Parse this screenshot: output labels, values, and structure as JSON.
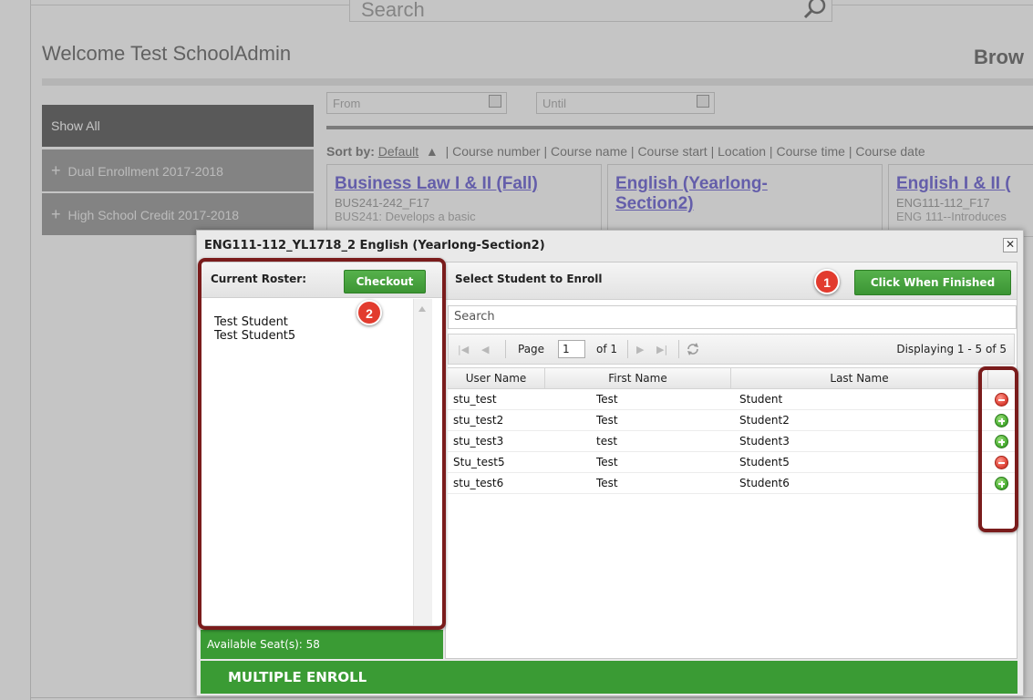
{
  "background": {
    "search_text": "Search",
    "welcome": "Welcome Test SchoolAdmin",
    "browse_fragment": "Brow",
    "sidebar": [
      {
        "label": "Show All",
        "prefix": ""
      },
      {
        "label": "Dual Enrollment 2017-2018",
        "prefix": "+"
      },
      {
        "label": "High School Credit 2017-2018",
        "prefix": "+"
      }
    ],
    "from_placeholder": "From",
    "until_placeholder": "Until",
    "sort_prefix": "Sort by:",
    "sort_default": "Default",
    "sort_rest": " | Course number | Course name | Course start | Location | Course time | Course date",
    "cards": [
      {
        "title": "Business Law I & II (Fall)",
        "code": "BUS241-242_F17",
        "desc": "BUS241: Develops a basic"
      },
      {
        "title": "English (Yearlong-Section2)",
        "code": "",
        "desc": ""
      },
      {
        "title": "English I & II (",
        "code": "ENG111-112_F17",
        "desc": "ENG 111--Introduces"
      }
    ]
  },
  "modal": {
    "title": "ENG111-112_YL1718_2 English (Yearlong-Section2)",
    "close_glyph": "✕",
    "roster": {
      "label": "Current Roster:",
      "checkout_label": "Checkout",
      "students": [
        "Test Student",
        "Test Student5"
      ]
    },
    "seats_text": "Available Seat(s): 58",
    "multiple_enroll": "MULTIPLE ENROLL",
    "enroll": {
      "label": "Select Student to Enroll",
      "finish_label": "Click When Finished",
      "search_value": "Search",
      "pager": {
        "page_label": "Page",
        "page_value": "1",
        "of_label": "of 1",
        "display_text": "Displaying 1 - 5 of 5"
      },
      "columns": [
        "User Name",
        "First Name",
        "Last Name"
      ],
      "rows": [
        {
          "user": "stu_test",
          "first": "Test",
          "last": "Student",
          "action": "remove"
        },
        {
          "user": "stu_test2",
          "first": "Test",
          "last": "Student2",
          "action": "add"
        },
        {
          "user": "stu_test3",
          "first": "test",
          "last": "Student3",
          "action": "add"
        },
        {
          "user": "Stu_test5",
          "first": "Test",
          "last": "Student5",
          "action": "remove"
        },
        {
          "user": "stu_test6",
          "first": "Test",
          "last": "Student6",
          "action": "add"
        }
      ]
    }
  },
  "annotations": {
    "badge_1": "1",
    "badge_2": "2"
  },
  "colors": {
    "accent_green": "#3a9b34",
    "highlight": "#7a1c1c",
    "badge_red": "#e23b2e",
    "link_purple": "#6b61d6"
  }
}
